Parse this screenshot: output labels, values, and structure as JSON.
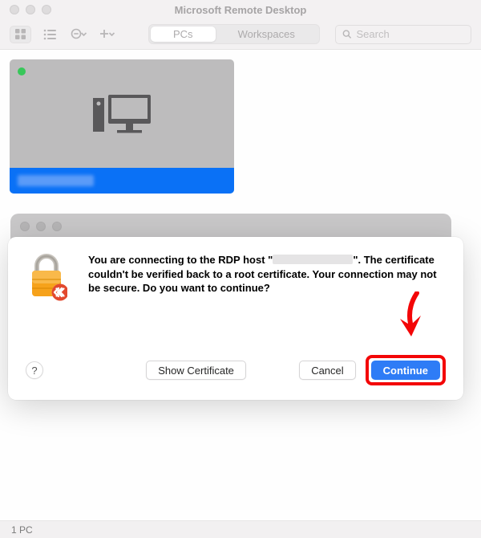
{
  "window": {
    "title": "Microsoft Remote Desktop"
  },
  "toolbar": {
    "tabs": {
      "pcs": "PCs",
      "workspaces": "Workspaces"
    },
    "search_placeholder": "Search"
  },
  "dialog": {
    "message_prefix": "You are connecting to the RDP host \"",
    "message_suffix": "\". The certificate couldn't be verified back to a root certificate. Your connection may not be secure. Do you want to continue?",
    "help_label": "?",
    "show_certificate": "Show Certificate",
    "cancel": "Cancel",
    "continue": "Continue"
  },
  "status": {
    "text": "1 PC"
  }
}
